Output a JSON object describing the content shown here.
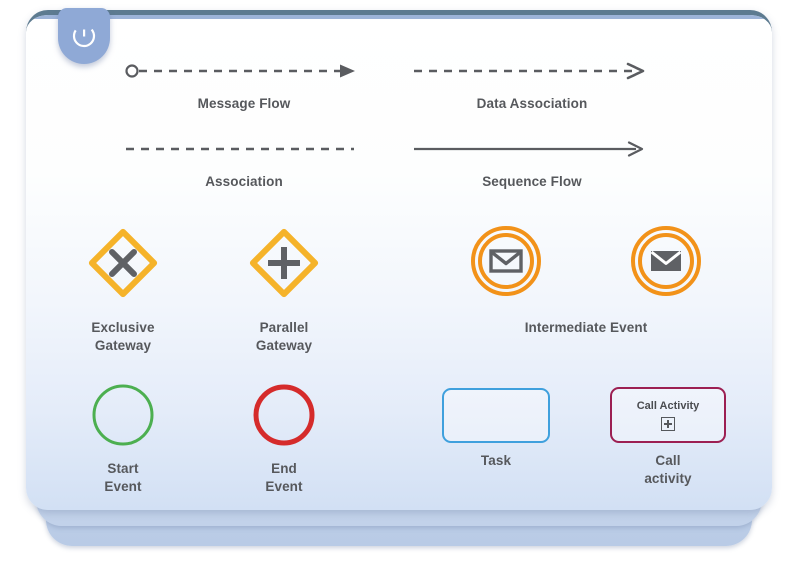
{
  "legend": {
    "logo": {
      "icon": "letter-c-logo-icon"
    },
    "colors": {
      "card_border_top": "#5d7b90",
      "gateway": "#f5b32a",
      "event_intermediate": "#f29219",
      "start_event": "#4caf50",
      "end_event": "#d52b2b",
      "task": "#3fa0dd",
      "call_activity": "#9c1f52",
      "connector": "#5a5c60",
      "label": "#56585c"
    },
    "connectors": [
      {
        "id": "message-flow",
        "label": "Message Flow",
        "line_style": "dashed",
        "start_marker": "hollow-circle",
        "end_marker": "hollow-arrowhead"
      },
      {
        "id": "data-association",
        "label": "Data Association",
        "line_style": "dashed",
        "start_marker": "none",
        "end_marker": "open-arrowhead"
      },
      {
        "id": "association",
        "label": "Association",
        "line_style": "dashed",
        "start_marker": "none",
        "end_marker": "none"
      },
      {
        "id": "sequence-flow",
        "label": "Sequence Flow",
        "line_style": "solid",
        "start_marker": "none",
        "end_marker": "open-arrowhead"
      }
    ],
    "gateways": [
      {
        "id": "exclusive-gateway",
        "label": "Exclusive\nGateway",
        "shape": "diamond",
        "marker": "x-cross-icon",
        "color": "#f5b32a"
      },
      {
        "id": "parallel-gateway",
        "label": "Parallel\nGateway",
        "shape": "diamond",
        "marker": "plus-cross-icon",
        "color": "#f5b32a"
      }
    ],
    "events_intermediate": {
      "label": "Intermediate Event",
      "items": [
        {
          "id": "intermediate-catch-message-event",
          "shape": "double-circle",
          "marker": "envelope-outline-icon",
          "color": "#f29219"
        },
        {
          "id": "intermediate-throw-message-event",
          "shape": "double-circle",
          "marker": "envelope-filled-icon",
          "color": "#f29219"
        }
      ]
    },
    "elements": [
      {
        "id": "start-event",
        "label": "Start\nEvent",
        "shape": "circle",
        "color": "#4caf50"
      },
      {
        "id": "end-event",
        "label": "End\nEvent",
        "shape": "circle-thick",
        "color": "#d52b2b"
      },
      {
        "id": "task",
        "label": "Task",
        "shape": "rounded-rectangle",
        "color": "#3fa0dd",
        "inner_text": ""
      },
      {
        "id": "call-activity",
        "label": "Call\nactivity",
        "shape": "rounded-rectangle",
        "color": "#9c1f52",
        "inner_text": "Call Activity",
        "inner_marker": "boxed-plus-icon"
      }
    ]
  }
}
